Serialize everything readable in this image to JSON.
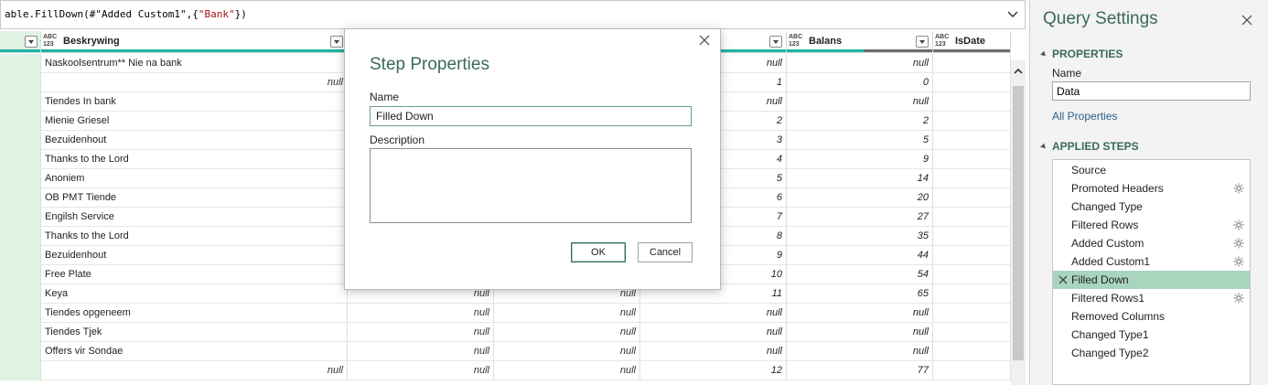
{
  "formula": {
    "prefix": "able.FillDown(#\"Added Custom1\",{",
    "string": "\"Bank\"",
    "suffix": "})",
    "expand_icon": "chevron-down-icon"
  },
  "grid": {
    "columns": [
      {
        "type": "ABC\n123",
        "title": "Beskrywing"
      },
      {
        "type": "ABC\n123",
        "title": "Balans"
      },
      {
        "type": "ABC\n123",
        "title": "IsDate"
      }
    ],
    "rows": [
      {
        "desc": "Naskoolsentrum** Nie na bank",
        "desc_null": "",
        "c3": "",
        "c4": "",
        "c5": "null",
        "balans": "null"
      },
      {
        "desc": "",
        "desc_null": "null",
        "c3": "",
        "c4": "",
        "c5": "1",
        "balans": "0"
      },
      {
        "desc": "Tiendes In bank",
        "desc_null": "",
        "c3": "",
        "c4": "",
        "c5": "null",
        "balans": "null"
      },
      {
        "desc": "Mienie Griesel",
        "desc_null": "",
        "c3": "",
        "c4": "",
        "c5": "2",
        "balans": "2"
      },
      {
        "desc": "Bezuidenhout",
        "desc_null": "",
        "c3": "",
        "c4": "",
        "c5": "3",
        "balans": "5"
      },
      {
        "desc": "Thanks to the Lord",
        "desc_null": "",
        "c3": "",
        "c4": "",
        "c5": "4",
        "balans": "9"
      },
      {
        "desc": "Anoniem",
        "desc_null": "",
        "c3": "",
        "c4": "",
        "c5": "5",
        "balans": "14"
      },
      {
        "desc": "OB PMT Tiende",
        "desc_null": "",
        "c3": "",
        "c4": "",
        "c5": "6",
        "balans": "20"
      },
      {
        "desc": "Engilsh Service",
        "desc_null": "",
        "c3": "",
        "c4": "",
        "c5": "7",
        "balans": "27"
      },
      {
        "desc": "Thanks to the Lord",
        "desc_null": "",
        "c3": "",
        "c4": "",
        "c5": "8",
        "balans": "35"
      },
      {
        "desc": "Bezuidenhout",
        "desc_null": "",
        "c3": "",
        "c4": "",
        "c5": "9",
        "balans": "44"
      },
      {
        "desc": "Free Plate",
        "desc_null": "",
        "c3": "",
        "c4": "",
        "c5": "10",
        "balans": "54"
      },
      {
        "desc": "Keya",
        "desc_null": "",
        "c3": "null",
        "c4": "null",
        "c5": "11",
        "balans": "65"
      },
      {
        "desc": "Tiendes opgeneem",
        "desc_null": "",
        "c3": "null",
        "c4": "null",
        "c5": "null",
        "balans": "null"
      },
      {
        "desc": "Tiendes Tjek",
        "desc_null": "",
        "c3": "null",
        "c4": "null",
        "c5": "null",
        "balans": "null"
      },
      {
        "desc": "Offers vir Sondae",
        "desc_null": "",
        "c3": "null",
        "c4": "null",
        "c5": "null",
        "balans": "null"
      },
      {
        "desc": "",
        "desc_null": "null",
        "c3": "null",
        "c4": "null",
        "c5": "12",
        "balans": "77"
      }
    ]
  },
  "dialog": {
    "title": "Step Properties",
    "name_label": "Name",
    "name_value": "Filled Down",
    "description_label": "Description",
    "description_value": "",
    "ok_label": "OK",
    "cancel_label": "Cancel"
  },
  "pane": {
    "title": "Query Settings",
    "properties_header": "PROPERTIES",
    "name_label": "Name",
    "name_value": "Data",
    "all_properties": "All Properties",
    "applied_steps_header": "APPLIED STEPS",
    "steps": [
      {
        "label": "Source",
        "gear": false
      },
      {
        "label": "Promoted Headers",
        "gear": true
      },
      {
        "label": "Changed Type",
        "gear": false
      },
      {
        "label": "Filtered Rows",
        "gear": true
      },
      {
        "label": "Added Custom",
        "gear": true
      },
      {
        "label": "Added Custom1",
        "gear": true
      },
      {
        "label": "Filled Down",
        "gear": false,
        "selected": true
      },
      {
        "label": "Filtered Rows1",
        "gear": true
      },
      {
        "label": "Removed Columns",
        "gear": false
      },
      {
        "label": "Changed Type1",
        "gear": false
      },
      {
        "label": "Changed Type2",
        "gear": false
      }
    ]
  }
}
